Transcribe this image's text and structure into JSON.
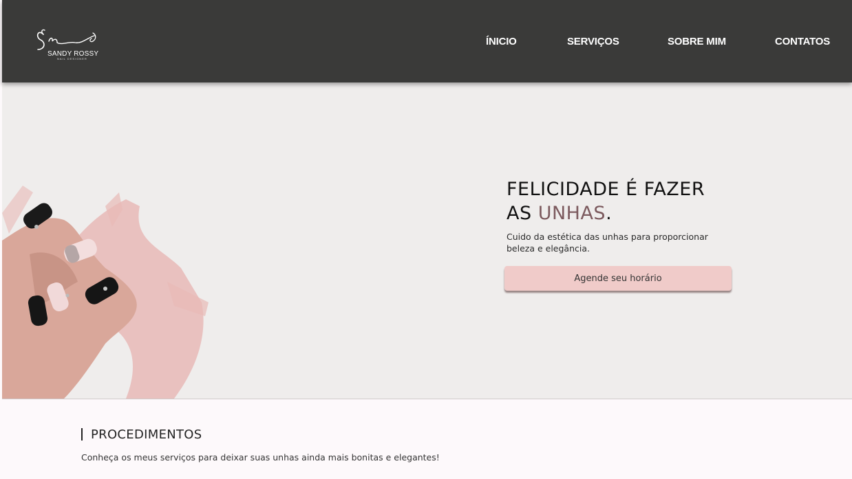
{
  "colors": {
    "header_bg": "#3a3a39",
    "hero_bg": "#efedec",
    "accent": "#7c5a5e",
    "button_bg": "#f0cbc9",
    "brush_pink": "#e8b9b7"
  },
  "header": {
    "logo": {
      "monogram": "Sr",
      "name": "SANDY ROSSY",
      "subtitle": "NAIL DESIGNER"
    },
    "nav": [
      {
        "label": "ÍNICIO"
      },
      {
        "label": "SERVIÇOS"
      },
      {
        "label": "SOBRE MIM"
      },
      {
        "label": "CONTATOS"
      }
    ]
  },
  "hero": {
    "title_line1": "FELICIDADE É FAZER",
    "title_line2_prefix": "AS ",
    "title_line2_accent": "UNHAS",
    "title_line2_suffix": ".",
    "description": "Cuido da estética das unhas para proporcionar beleza e elegância.",
    "cta_label": "Agende seu horário",
    "image_icon": "manicured-hand-image"
  },
  "procedures": {
    "title": "PROCEDIMENTOS",
    "description": "Conheça os meus serviços para deixar suas unhas ainda mais bonitas e elegantes!"
  }
}
